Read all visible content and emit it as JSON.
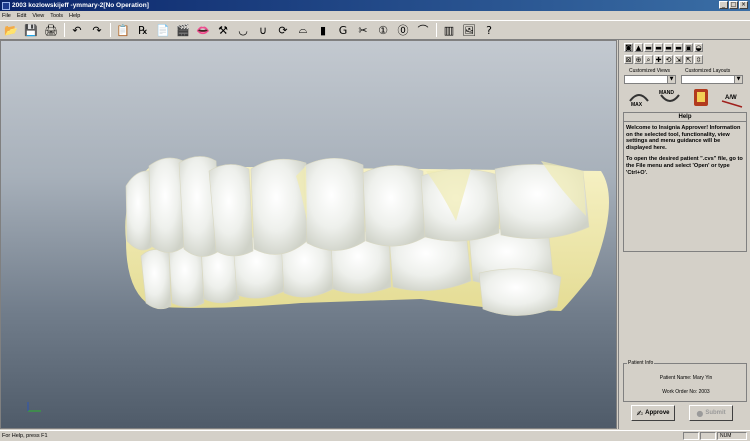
{
  "window": {
    "title": "2003 kozlowskijeff -ymmary-2[No Operation]",
    "controls": [
      "minimize",
      "maximize",
      "close"
    ]
  },
  "menu": [
    "File",
    "Edit",
    "View",
    "Tools",
    "Help"
  ],
  "toolbar": [
    {
      "icon": "open-folder-icon",
      "glyph": "📂"
    },
    {
      "icon": "save-icon",
      "glyph": "💾"
    },
    {
      "icon": "print-icon",
      "glyph": "🖨"
    },
    {
      "icon": "undo-icon",
      "glyph": "↶"
    },
    {
      "icon": "redo-icon",
      "glyph": "↷"
    },
    {
      "icon": "notes-icon",
      "glyph": "📋"
    },
    {
      "icon": "prescription-icon",
      "glyph": "℞"
    },
    {
      "icon": "form-icon",
      "glyph": "📄"
    },
    {
      "icon": "clapperboard-icon",
      "glyph": "🎬"
    },
    {
      "icon": "lips-icon",
      "glyph": "👄"
    },
    {
      "icon": "pliers-icon",
      "glyph": "⚒"
    },
    {
      "icon": "arch-icon",
      "glyph": "◡"
    },
    {
      "icon": "curve-icon",
      "glyph": "∪"
    },
    {
      "icon": "rotate-icon",
      "glyph": "⟳"
    },
    {
      "icon": "jaw-icon",
      "glyph": "⌓"
    },
    {
      "icon": "tooth-icon",
      "glyph": "▮"
    },
    {
      "icon": "g-icon",
      "glyph": "G"
    },
    {
      "icon": "scissors-icon",
      "glyph": "✂"
    },
    {
      "icon": "t1-icon",
      "glyph": "①"
    },
    {
      "icon": "t0-icon",
      "glyph": "⓪"
    },
    {
      "icon": "ipr-icon",
      "glyph": "⌒"
    },
    {
      "icon": "layout-icon",
      "glyph": "▥"
    },
    {
      "icon": "image-icon",
      "glyph": "🖼"
    },
    {
      "icon": "help-icon",
      "glyph": "?"
    }
  ],
  "side_panel": {
    "icon_row_1": [
      "◙",
      "▲",
      "▬",
      "▬",
      "▬",
      "▬",
      "▣",
      "◒"
    ],
    "icon_row_2": [
      "⊠",
      "⊕",
      "⌕",
      "✚",
      "⟲",
      "⇲",
      "⇱",
      "⇳"
    ],
    "customized_views_label": "Customized Views",
    "customized_layouts_label": "Customized Layouts",
    "max_label": "MAX",
    "mand_label": "MAND",
    "aw_label": "A/W",
    "help": {
      "title": "Help",
      "paragraph_1": "Welcome to Insignia Approver! Information on the selected tool, functionality, view settings and menu guidance will be displayed here.",
      "paragraph_2": "To open the desired patient \".cvs\" file, go to the File menu and select 'Open' or type 'Ctrl+O'."
    },
    "patient_info": {
      "legend": "Patient Info",
      "name": "Patient Name: Mary Yin",
      "work_order": "Work Order No: 2003"
    },
    "approve_label": "Approve",
    "submit_label": "Submit"
  },
  "status": {
    "text": "For Help, press F1",
    "num": "NUM"
  },
  "colors": {
    "title_bar": "#0a246a",
    "tooth_enamel": "#f4f4ee",
    "gum_cast": "#f0ebb2",
    "viewport_top": "#c3c9d0",
    "viewport_bottom": "#4f5b69"
  }
}
